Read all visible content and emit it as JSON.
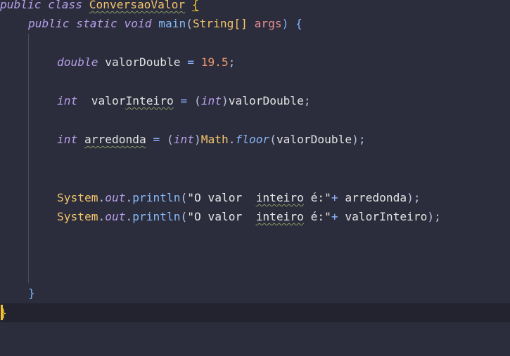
{
  "code": {
    "line1": {
      "kw_public": "public",
      "kw_class": "class",
      "class_name": "ConversaoValor",
      "open_brace": "{"
    },
    "line2": {
      "kw_public": "public",
      "kw_static": "static",
      "kw_void": "void",
      "method_name": "main",
      "open_paren": "(",
      "param_type": "String[]",
      "param_name": "args",
      "close_paren_brace": ") {"
    },
    "line3": {
      "type": "double",
      "var_name": "valorDouble",
      "assign": "=",
      "value": "19.5",
      "semicolon": ";"
    },
    "line4": {
      "type": "int",
      "var_prefix": "valor",
      "var_squiggle": "Inteiro",
      "assign": "=",
      "open_paren": "(",
      "cast_type": "int",
      "close_paren": ")",
      "operand": "valorDouble",
      "semicolon": ";"
    },
    "line5": {
      "type": "int",
      "var_name": "arredonda",
      "assign": "=",
      "open_paren": "(",
      "cast_type": "int",
      "close_paren": ")",
      "class_ref": "Math",
      "dot": ".",
      "method": "floor",
      "open_call": "(",
      "arg": "valorDouble",
      "close_call": ");"
    },
    "line6": {
      "class_ref": "System",
      "dot1": ".",
      "field": "out",
      "dot2": ".",
      "method": "println",
      "open_call": "(",
      "str_part1": "\"O valor  ",
      "str_squiggle": "inteiro",
      "str_part2": " é:\"",
      "plus": "+",
      "arg": "arredonda",
      "close_call": ");"
    },
    "line7": {
      "class_ref": "System",
      "dot1": ".",
      "field": "out",
      "dot2": ".",
      "method": "println",
      "open_call": "(",
      "str_part1": "\"O valor  ",
      "str_squiggle": "inteiro",
      "str_part2": " é:\"",
      "plus": "+",
      "arg": "valorInteiro",
      "close_call": ");"
    },
    "line8": {
      "close_brace": "}"
    },
    "line9": {
      "close_brace": "}"
    }
  }
}
